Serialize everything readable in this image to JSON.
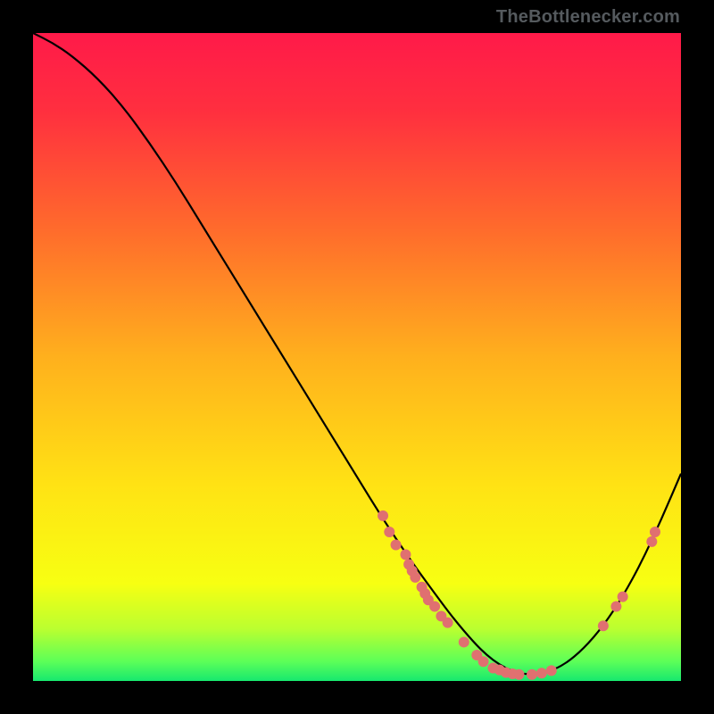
{
  "watermark": "TheBottlenecker.com",
  "chart_data": {
    "type": "line",
    "title": "",
    "xlabel": "",
    "ylabel": "",
    "xlim": [
      0,
      100
    ],
    "ylim": [
      0,
      100
    ],
    "gradient_stops": [
      {
        "offset": 0.0,
        "color": "#ff1a49"
      },
      {
        "offset": 0.12,
        "color": "#ff2f3f"
      },
      {
        "offset": 0.3,
        "color": "#ff6a2c"
      },
      {
        "offset": 0.5,
        "color": "#ffb01d"
      },
      {
        "offset": 0.7,
        "color": "#ffe314"
      },
      {
        "offset": 0.85,
        "color": "#f7ff12"
      },
      {
        "offset": 0.92,
        "color": "#baff30"
      },
      {
        "offset": 0.97,
        "color": "#5cff58"
      },
      {
        "offset": 1.0,
        "color": "#17e86f"
      }
    ],
    "series": [
      {
        "name": "curve",
        "stroke": "#000000",
        "x": [
          0,
          3,
          6,
          10,
          14,
          18,
          22,
          26,
          30,
          34,
          38,
          42,
          46,
          50,
          54,
          58,
          62,
          65,
          68,
          70,
          72,
          74,
          76,
          79,
          82,
          85,
          88,
          91,
          94,
          97,
          100
        ],
        "y": [
          100,
          98.5,
          96.5,
          93,
          88.5,
          83,
          77,
          70.5,
          64,
          57.5,
          51,
          44.5,
          38,
          31.5,
          25,
          19,
          13.5,
          9.5,
          6,
          4,
          2.5,
          1.5,
          1,
          1.2,
          2.5,
          5,
          8.5,
          13,
          18.5,
          25,
          32
        ]
      }
    ],
    "scatter": {
      "color": "#e07070",
      "r": 6,
      "points": [
        {
          "x": 54,
          "y": 25.5
        },
        {
          "x": 55,
          "y": 23
        },
        {
          "x": 56,
          "y": 21
        },
        {
          "x": 57.5,
          "y": 19.5
        },
        {
          "x": 58,
          "y": 18
        },
        {
          "x": 58.5,
          "y": 17
        },
        {
          "x": 59,
          "y": 16
        },
        {
          "x": 60,
          "y": 14.5
        },
        {
          "x": 60.5,
          "y": 13.5
        },
        {
          "x": 61,
          "y": 12.5
        },
        {
          "x": 62,
          "y": 11.5
        },
        {
          "x": 63,
          "y": 10
        },
        {
          "x": 64,
          "y": 9
        },
        {
          "x": 66.5,
          "y": 6
        },
        {
          "x": 68.5,
          "y": 4
        },
        {
          "x": 69.5,
          "y": 3
        },
        {
          "x": 71,
          "y": 2
        },
        {
          "x": 72,
          "y": 1.7
        },
        {
          "x": 73,
          "y": 1.3
        },
        {
          "x": 74,
          "y": 1.1
        },
        {
          "x": 75,
          "y": 1
        },
        {
          "x": 77,
          "y": 1
        },
        {
          "x": 78.5,
          "y": 1.2
        },
        {
          "x": 80,
          "y": 1.6
        },
        {
          "x": 88,
          "y": 8.5
        },
        {
          "x": 90,
          "y": 11.5
        },
        {
          "x": 91,
          "y": 13
        },
        {
          "x": 95.5,
          "y": 21.5
        },
        {
          "x": 96,
          "y": 23
        }
      ]
    }
  }
}
